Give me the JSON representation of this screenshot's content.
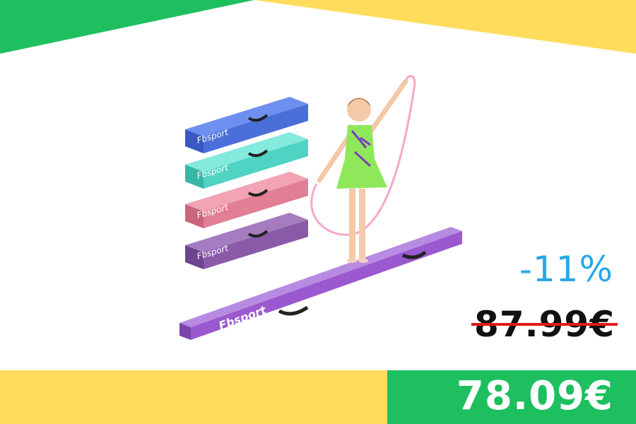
{
  "promo": {
    "discount": "-11%",
    "old_price": "87.99€",
    "new_price": "78.09€"
  },
  "product": {
    "brand_logo_text": "Fbsport",
    "beam_colors": [
      "#4a6fd8",
      "#4fd3c2",
      "#e27f95",
      "#8a5aa8",
      "#9b59d0"
    ],
    "outfit_color": "#8ee85a"
  },
  "colors": {
    "accent_yellow": "#ffdc5c",
    "accent_green": "#1dbf5f",
    "discount_blue": "#29a8e8",
    "strike_red": "#e01b1b"
  }
}
